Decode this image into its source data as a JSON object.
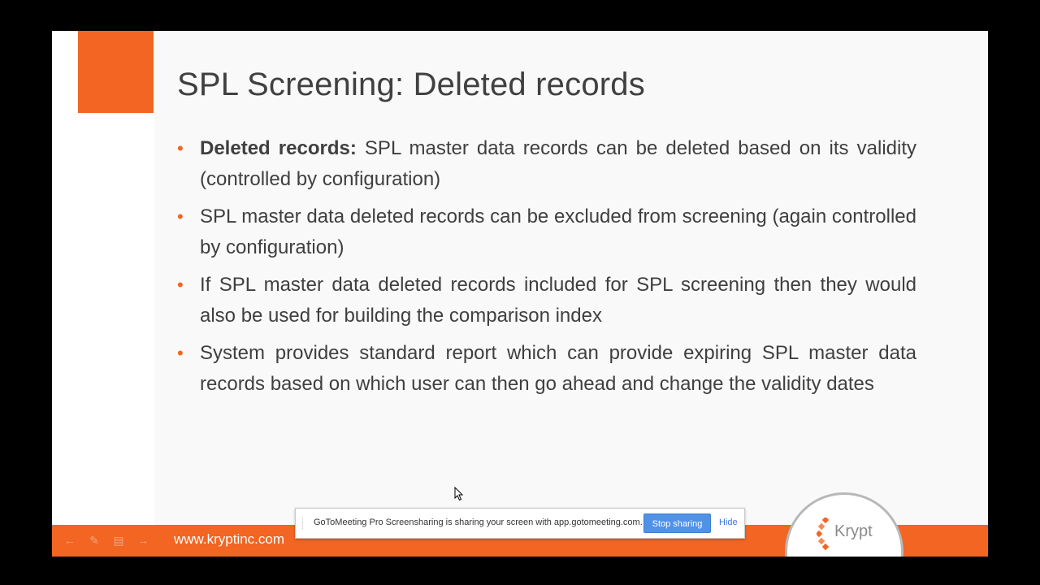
{
  "slide": {
    "title": "SPL Screening: Deleted records",
    "bullets": [
      {
        "strong": "Deleted records:",
        "text": " SPL master data records can be deleted based on its validity (controlled by configuration)"
      },
      {
        "strong": "",
        "text": "SPL master data deleted records can be excluded from screening (again controlled by configuration)"
      },
      {
        "strong": "",
        "text": "If SPL master data deleted records included for SPL screening then they would also be used for building the comparison index"
      },
      {
        "strong": "",
        "text": "System provides standard report which can provide expiring SPL master data records based on which user can then go ahead and change the validity dates"
      }
    ],
    "bullet_marker": "•",
    "footer_url": "www.kryptinc.com",
    "logo_text": "Krypt",
    "colors": {
      "accent": "#f26522",
      "text": "#3f3f3f",
      "background": "#f9f9f9"
    }
  },
  "share_bar": {
    "message": "GoToMeeting Pro Screensharing is sharing your screen with app.gotomeeting.com.",
    "stop_label": "Stop sharing",
    "hide_label": "Hide",
    "button_color": "#4f92e6"
  },
  "icons": {
    "footer_controls": [
      "back-arrow-icon",
      "pen-icon",
      "slides-icon",
      "forward-arrow-icon"
    ],
    "pointer": "mouse-pointer-icon"
  }
}
